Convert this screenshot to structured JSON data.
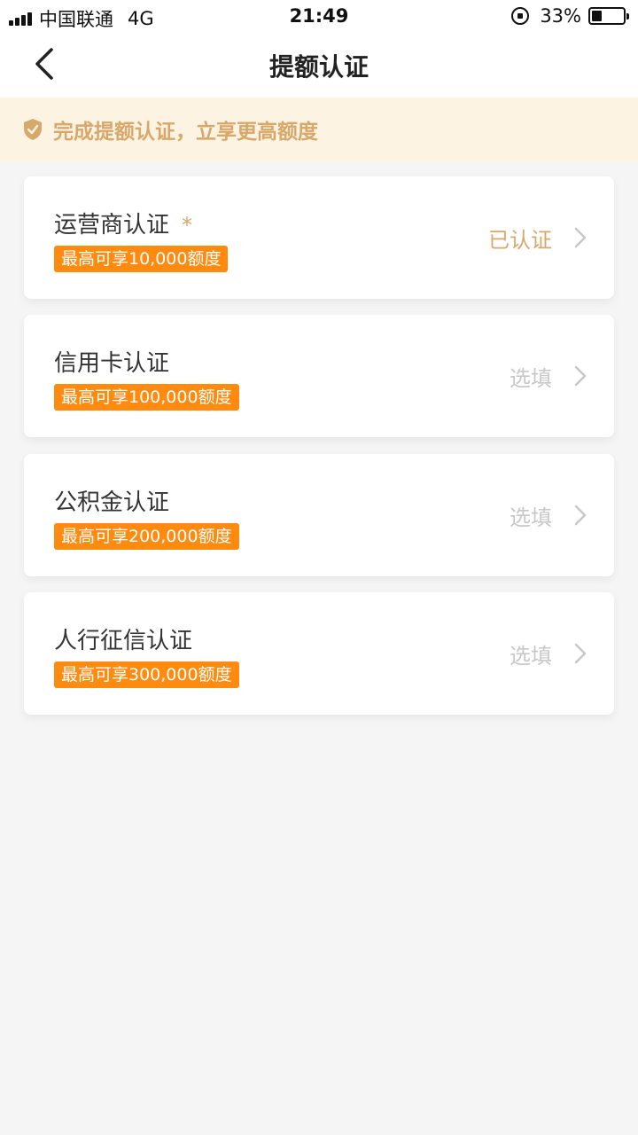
{
  "status_bar": {
    "carrier": "中国联通",
    "network": "4G",
    "time": "21:49",
    "battery": "33%",
    "battery_level": 0.33
  },
  "nav": {
    "title": "提额认证"
  },
  "notice": {
    "text": "完成提额认证，立享更高额度"
  },
  "cards": [
    {
      "title": "运营商认证",
      "required_mark": "*",
      "badge": "最高可享10,000额度",
      "status": "已认证"
    },
    {
      "title": "信用卡认证",
      "badge": "最高可享100,000额度",
      "status": "选填"
    },
    {
      "title": "公积金认证",
      "badge": "最高可享200,000额度",
      "status": "选填"
    },
    {
      "title": "人行征信认证",
      "badge": "最高可享300,000额度",
      "status": "选填"
    }
  ],
  "colors": {
    "accent_gold": "#d8a86a",
    "badge_orange": "#ff8a10",
    "notice_bg": "#fdf3e2"
  }
}
